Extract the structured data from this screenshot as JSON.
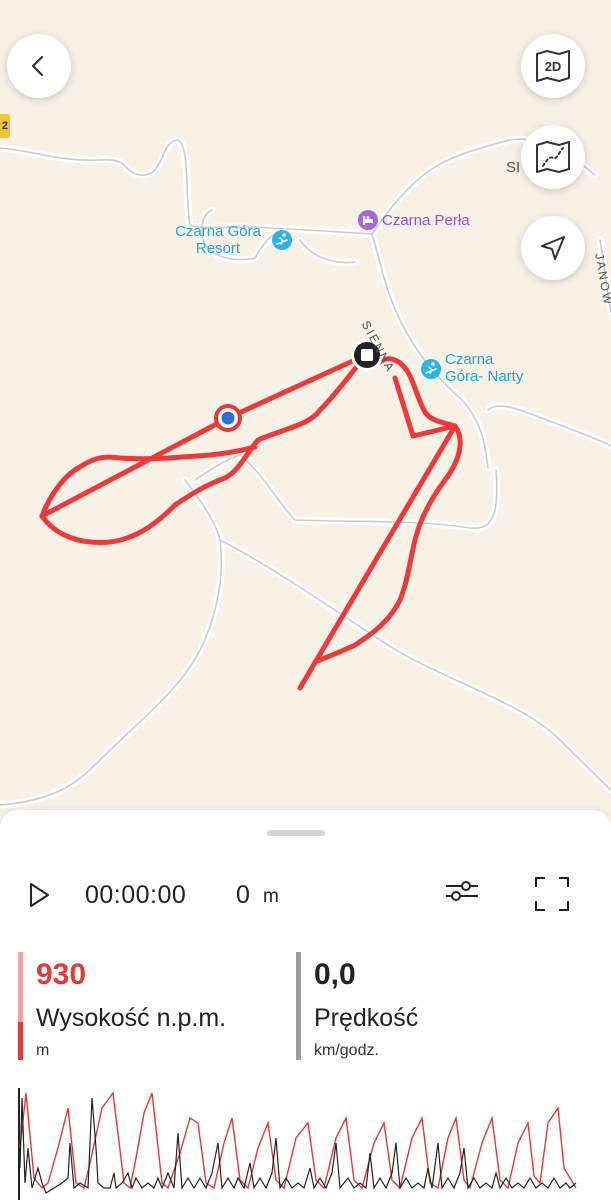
{
  "map": {
    "places": [
      {
        "name": "Czarna Góra\nResort",
        "color": "#1aa6e0",
        "icon": "ski-icon"
      },
      {
        "name": "Czarna Perła",
        "color": "#9a4fd6",
        "icon": "hotel-icon"
      },
      {
        "name": "Czarna\nGóra- Narty",
        "color": "#1aa6e0",
        "icon": "ski-icon"
      }
    ],
    "roads": [
      "SIENNA",
      "JANOW",
      "SI"
    ],
    "road_badge": "2",
    "track_color": "#f0383b"
  },
  "buttons": {
    "back_icon": "chevron-left-icon",
    "view_mode_label": "2D",
    "map_layers_icon": "map-layers-icon",
    "locate_icon": "navigation-arrow-icon"
  },
  "player": {
    "elapsed_time": "00:00:00",
    "distance_value": "0",
    "distance_unit": "m"
  },
  "metrics": {
    "altitude": {
      "value": "930",
      "label": "Wysokość n.p.m.",
      "unit": "m",
      "color": "#e53935"
    },
    "speed": {
      "value": "0,0",
      "label": "Prędkość",
      "unit": "km/godz.",
      "color": "#222222"
    }
  },
  "colors": {
    "accent": "#e53935",
    "altitude_line": "#e53935",
    "speed_line": "#222222"
  }
}
